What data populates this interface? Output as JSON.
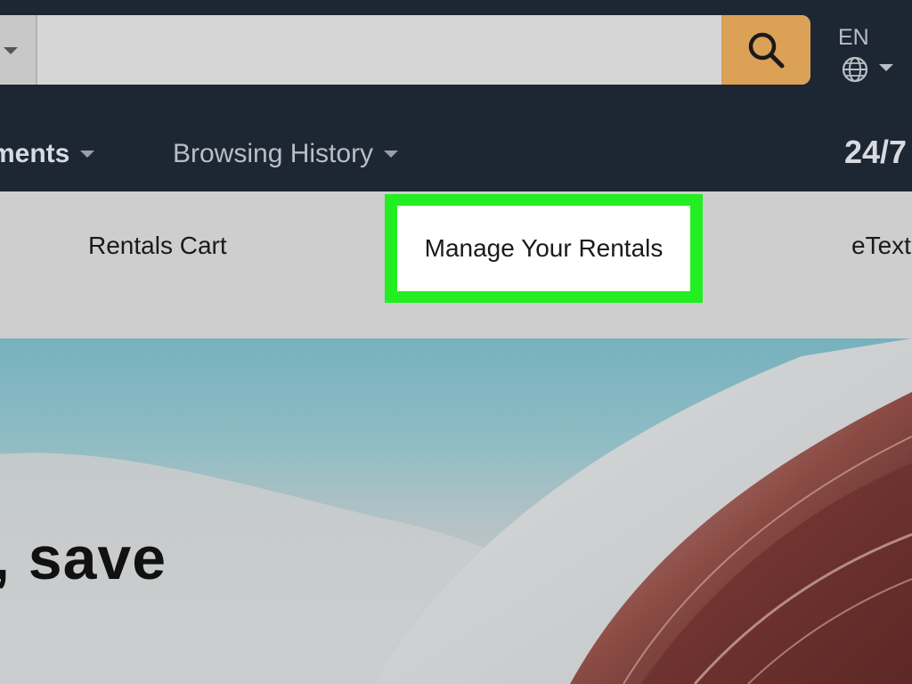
{
  "header": {
    "search": {
      "value": "",
      "placeholder": ""
    },
    "language": {
      "code": "EN"
    }
  },
  "nav": {
    "departments_label": "tments",
    "browsing_history_label": "Browsing History",
    "support_label": "24/7"
  },
  "subnav": {
    "items": [
      {
        "label": "Rentals Cart"
      },
      {
        "label": "Manage Your Rentals"
      },
      {
        "label": "eText"
      }
    ],
    "highlight_color": "#22ee22"
  },
  "hero": {
    "headline": ", save"
  },
  "colors": {
    "header_bg": "#1d2633",
    "search_button": "#dba156",
    "subnav_bg": "#cecece"
  },
  "icons": {
    "search": "search-icon",
    "globe": "globe-icon"
  }
}
